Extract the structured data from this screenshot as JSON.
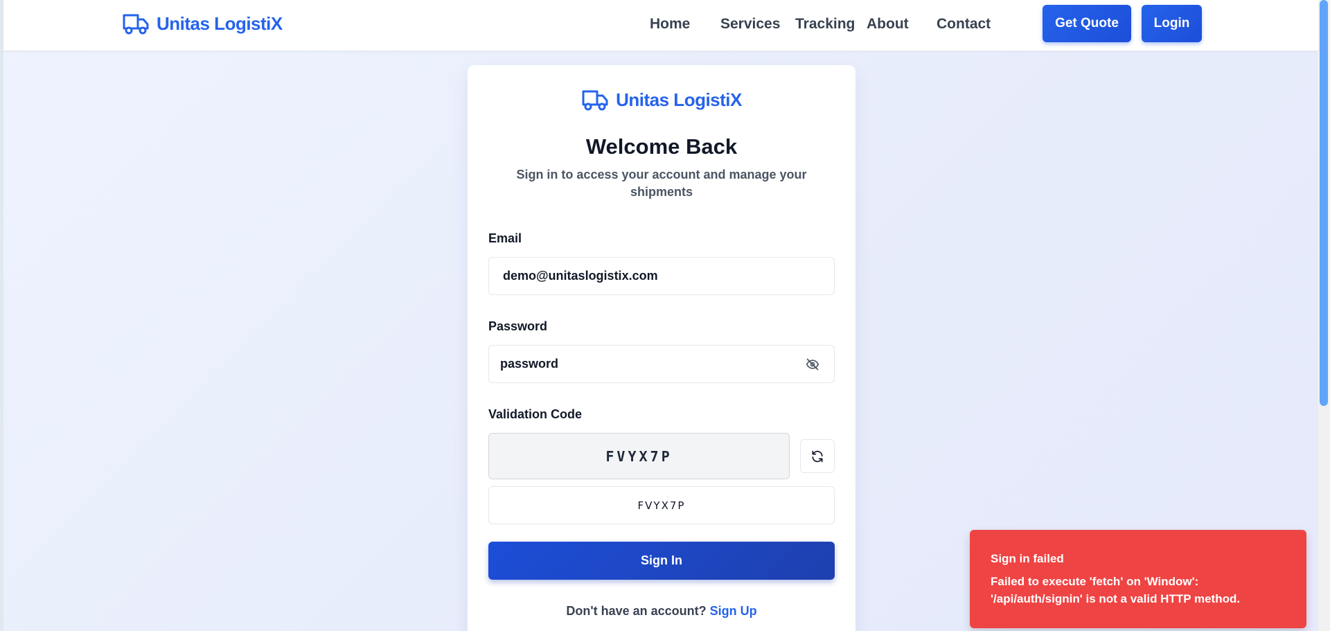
{
  "nav": {
    "brand": "Unitas LogistiX",
    "links": [
      "Home",
      "Services",
      "Tracking",
      "About",
      "Contact"
    ],
    "quote_label": "Get Quote",
    "login_label": "Login"
  },
  "colors": {
    "brand": "#2563eb",
    "primary_button": "#1d4ed8",
    "toast_error": "#ef4444"
  },
  "card": {
    "brand": "Unitas LogistiX",
    "title": "Welcome Back",
    "subtitle": "Sign in to access your account and manage your shipments",
    "email_label": "Email",
    "email_value": "demo@unitaslogistix.com",
    "password_label": "Password",
    "password_value": "password",
    "validation_label": "Validation Code",
    "captcha_code": "FVYX7P",
    "code_input_value": "FVYX7P",
    "signin_label": "Sign In",
    "signup_prompt": "Don't have an account?",
    "signup_link": "Sign Up"
  },
  "toast": {
    "title": "Sign in failed",
    "message": "Failed to execute 'fetch' on 'Window': '/api/auth/signin' is not a valid HTTP method."
  },
  "icons": {
    "truck": "truck-icon",
    "eye_off": "eye-off-icon",
    "refresh": "refresh-icon"
  }
}
